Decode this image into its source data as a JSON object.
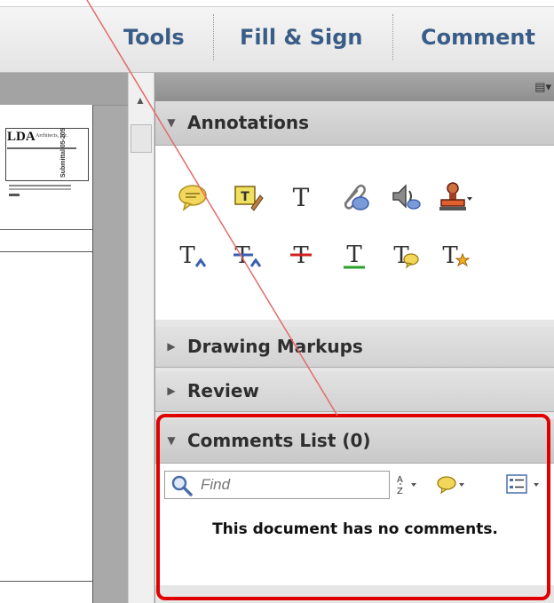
{
  "toolbar": {
    "tools": "Tools",
    "fill_sign": "Fill & Sign",
    "comment": "Comment"
  },
  "document": {
    "logo_text": "LDA",
    "logo_sub": "Architects, Inc.",
    "side_stamp": "Submittal 05-205"
  },
  "panel": {
    "options_icon": "panel-options-icon",
    "annotations_label": "Annotations",
    "drawing_markups_label": "Drawing Markups",
    "review_label": "Review",
    "comments_list_label": "Comments List (0)",
    "search_placeholder": "Find",
    "empty_message": "This document has no comments."
  },
  "annotation_tools": [
    {
      "icon": "sticky-note-icon",
      "color": "#f3d75a"
    },
    {
      "icon": "text-box-icon",
      "color": "#f0e060"
    },
    {
      "icon": "text-tool-icon",
      "color": "#333333"
    },
    {
      "icon": "attach-file-icon",
      "color": "#5a78b5"
    },
    {
      "icon": "record-audio-icon",
      "color": "#6a6a6a"
    },
    {
      "icon": "stamp-icon",
      "color": "#c05020"
    },
    {
      "icon": "insert-text-icon",
      "color": "#3a5fb0"
    },
    {
      "icon": "replace-text-icon",
      "color": "#3a5fb0"
    },
    {
      "icon": "strikethrough-icon",
      "color": "#d02020"
    },
    {
      "icon": "underline-icon",
      "color": "#2aa02a"
    },
    {
      "icon": "add-note-to-text-icon",
      "color": "#f0c840"
    },
    {
      "icon": "highlight-text-icon",
      "color": "#f0b020"
    }
  ],
  "colors": {
    "accent": "#3a5d87",
    "highlight_frame": "#e00000"
  }
}
